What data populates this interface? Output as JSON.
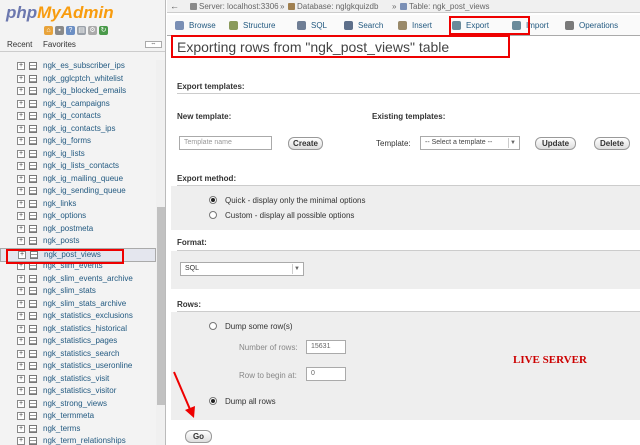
{
  "sidebar": {
    "logo_php": "php",
    "logo_admin": "MyAdmin",
    "tab_recent": "Recent",
    "tab_favorites": "Favorites",
    "collapse_symbol": "⇔",
    "tables": [
      "ngk_es_subscriber_ips",
      "ngk_gglcptch_whitelist",
      "ngk_ig_blocked_emails",
      "ngk_ig_campaigns",
      "ngk_ig_contacts",
      "ngk_ig_contacts_ips",
      "ngk_ig_forms",
      "ngk_ig_lists",
      "ngk_ig_lists_contacts",
      "ngk_ig_mailing_queue",
      "ngk_ig_sending_queue",
      "ngk_links",
      "ngk_options",
      "ngk_postmeta",
      "ngk_posts",
      "ngk_post_views",
      "ngk_slim_events",
      "ngk_slim_events_archive",
      "ngk_slim_stats",
      "ngk_slim_stats_archive",
      "ngk_statistics_exclusions",
      "ngk_statistics_historical",
      "ngk_statistics_pages",
      "ngk_statistics_search",
      "ngk_statistics_useronline",
      "ngk_statistics_visit",
      "ngk_statistics_visitor",
      "ngk_strong_views",
      "ngk_termmeta",
      "ngk_terms",
      "ngk_term_relationships"
    ],
    "selected_table": "ngk_post_views"
  },
  "breadcrumb": {
    "server": "Server: localhost:3306",
    "database": "Database: nglgkquizdb",
    "table": "Table: ngk_post_views",
    "separator": "»"
  },
  "menu_tabs": [
    {
      "label": "Browse",
      "icon": "browse-icon",
      "color": "#7a8fb5"
    },
    {
      "label": "Structure",
      "icon": "structure-icon",
      "color": "#8a9a5b"
    },
    {
      "label": "SQL",
      "icon": "sql-icon",
      "color": "#6f7e95"
    },
    {
      "label": "Search",
      "icon": "search-icon",
      "color": "#5d6f8a"
    },
    {
      "label": "Insert",
      "icon": "insert-icon",
      "color": "#9a8a6a"
    },
    {
      "label": "Export",
      "icon": "export-icon",
      "color": "#6a8a9a"
    },
    {
      "label": "Import",
      "icon": "import-icon",
      "color": "#6a8a9a"
    },
    {
      "label": "Operations",
      "icon": "operations-icon",
      "color": "#7a7a7a"
    }
  ],
  "page": {
    "title": "Exporting rows from \"ngk_post_views\" table"
  },
  "export_templates": {
    "heading": "Export templates:",
    "new_template_label": "New template:",
    "template_name_placeholder": "Template name",
    "create_button": "Create",
    "existing_templates_label": "Existing templates:",
    "template_label": "Template:",
    "select_placeholder": "-- Select a template --",
    "update_button": "Update",
    "delete_button": "Delete"
  },
  "export_method": {
    "heading": "Export method:",
    "quick": "Quick - display only the minimal options",
    "custom": "Custom - display all possible options",
    "selected": "quick"
  },
  "format": {
    "heading": "Format:",
    "value": "SQL"
  },
  "rows": {
    "heading": "Rows:",
    "dump_some": "Dump some row(s)",
    "number_of_rows_label": "Number of rows:",
    "number_of_rows_value": "15631",
    "row_to_begin_label": "Row to begin at:",
    "row_to_begin_value": "0",
    "dump_all": "Dump all rows",
    "selected": "all"
  },
  "go_button": "Go",
  "watermark": "LIVE SERVER",
  "colors": {
    "highlight_red": "#ee0000",
    "link_blue": "#235a81",
    "panel_gray": "#eeeeee"
  }
}
